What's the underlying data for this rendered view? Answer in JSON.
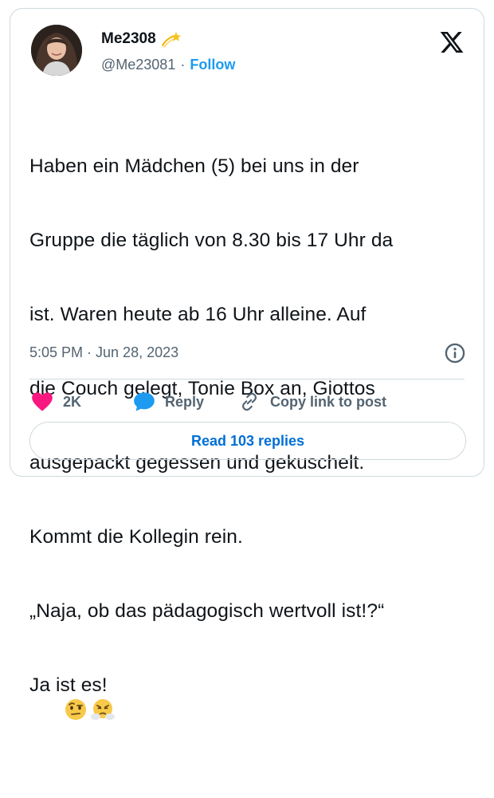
{
  "author": {
    "name": "Me2308",
    "name_badge_icon": "shooting-star-emoji",
    "handle": "@Me23081",
    "separator": "·",
    "follow_label": "Follow"
  },
  "logo_icon": "x-logo",
  "tweet": {
    "lines": [
      "Haben ein Mädchen (5) bei uns in der",
      "Gruppe die täglich von 8.30 bis 17 Uhr da",
      "ist. Waren heute ab 16 Uhr alleine. Auf",
      "die Couch gelegt, Tonie Box an, Giottos",
      "ausgepackt gegessen und gekuschelt.",
      "Kommt die Kollegin rein.",
      "„Naja, ob das pädagogisch wertvoll ist!?“",
      "Ja ist es!"
    ],
    "emojis": [
      "face-with-raised-eyebrow",
      "face-with-steam-from-nose"
    ],
    "timestamp": "5:05 PM · Jun 28, 2023"
  },
  "actions": {
    "like_count": "2K",
    "reply_label": "Reply",
    "copy_label": "Copy link to post"
  },
  "read_replies_label": "Read 103 replies",
  "colors": {
    "accent": "#1d9bf0",
    "link_button": "#006fd6",
    "like": "#f91880",
    "muted": "#536471",
    "border": "#cfd9de"
  }
}
